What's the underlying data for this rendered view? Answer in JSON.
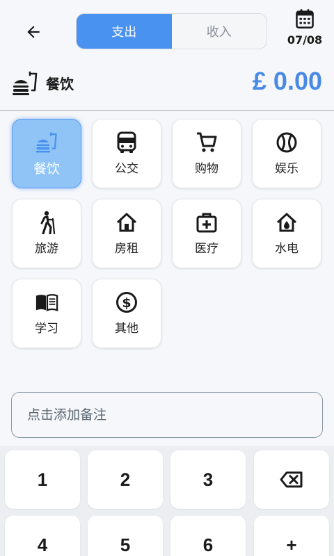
{
  "header": {
    "back_icon": "arrow-left-icon",
    "tabs": [
      {
        "label": "支出",
        "active": true
      },
      {
        "label": "收入",
        "active": false
      }
    ],
    "calendar_icon": "calendar-icon",
    "date": "07/08"
  },
  "summary": {
    "icon": "fastfood-icon",
    "category": "餐饮",
    "amount": "£ 0.00",
    "amount_color": "#4a8ae6"
  },
  "categories": [
    {
      "label": "餐饮",
      "icon": "fastfood-icon",
      "selected": true
    },
    {
      "label": "公交",
      "icon": "bus-icon"
    },
    {
      "label": "购物",
      "icon": "shopping-cart-icon"
    },
    {
      "label": "娱乐",
      "icon": "sports-ball-icon"
    },
    {
      "label": "旅游",
      "icon": "hiking-icon"
    },
    {
      "label": "房租",
      "icon": "house-icon"
    },
    {
      "label": "医疗",
      "icon": "medical-kit-icon"
    },
    {
      "label": "水电",
      "icon": "utility-home-icon"
    },
    {
      "label": "学习",
      "icon": "book-icon"
    },
    {
      "label": "其他",
      "icon": "dollar-circle-icon"
    }
  ],
  "note": {
    "placeholder": "点击添加备注",
    "value": ""
  },
  "keypad": {
    "keys": [
      "1",
      "2",
      "3",
      "⌫",
      "4",
      "5",
      "6",
      "+"
    ],
    "backspace_icon": "backspace-icon"
  },
  "colors": {
    "accent": "#4a92ef",
    "selected_tile": "#90c4f7",
    "background": "#f5f7fa"
  }
}
